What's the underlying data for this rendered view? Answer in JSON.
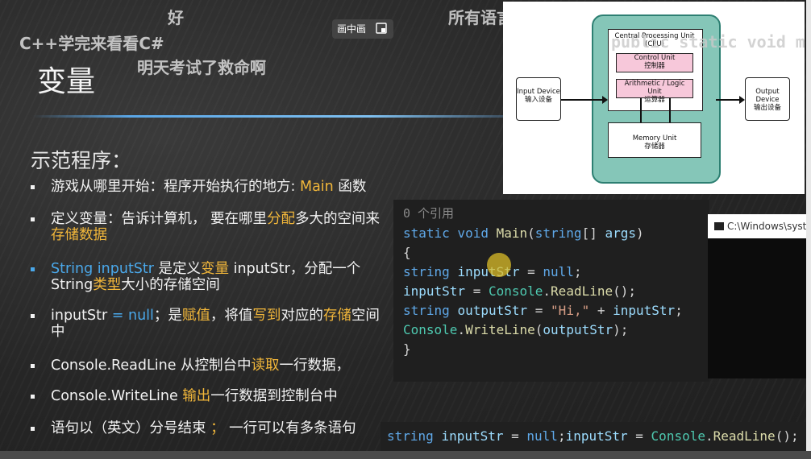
{
  "danmaku": {
    "line1": "好",
    "line2": "C++学完来看看C#",
    "line3": "明天考试了救命啊",
    "line4": "所有语言这个都差不多",
    "line5": "public static void m"
  },
  "pip_button": {
    "label": "画中画"
  },
  "slide": {
    "title": "变量",
    "section": "示范程序：",
    "bullets": [
      {
        "parts": [
          {
            "t": "游戏从哪里开始：程序开始执行的地方: "
          },
          {
            "t": "Main",
            "c": "hl"
          },
          {
            "t": " 函数"
          }
        ]
      },
      {
        "parts": [
          {
            "t": "定义变量：告诉计算机， 要在哪里"
          },
          {
            "t": "分配",
            "c": "hl"
          },
          {
            "t": "多大的空间来"
          },
          {
            "t": "存储数据",
            "c": "hl"
          }
        ]
      },
      {
        "parts": [
          {
            "t": "String inputStr ",
            "c": "kw"
          },
          {
            "t": "是定义"
          },
          {
            "t": "变量",
            "c": "hl"
          },
          {
            "t": " inputStr，分配一个String"
          },
          {
            "t": "类型",
            "c": "hl"
          },
          {
            "t": "大小的存储空间"
          }
        ]
      },
      {
        "parts": [
          {
            "t": "inputStr "
          },
          {
            "t": "= null",
            "c": "kw"
          },
          {
            "t": "；是"
          },
          {
            "t": "赋值",
            "c": "hl"
          },
          {
            "t": "，将值"
          },
          {
            "t": "写到",
            "c": "hl"
          },
          {
            "t": "对应的"
          },
          {
            "t": "存储",
            "c": "hl"
          },
          {
            "t": "空间中"
          }
        ]
      },
      {
        "parts": [
          {
            "t": "Console.ReadLine 从控制台中"
          },
          {
            "t": "读取",
            "c": "hl"
          },
          {
            "t": "一行数据，"
          }
        ]
      },
      {
        "parts": [
          {
            "t": "Console.WriteLine "
          },
          {
            "t": "输出",
            "c": "hl"
          },
          {
            "t": "一行数据到控制台中"
          }
        ]
      },
      {
        "parts": [
          {
            "t": "语句以（英文）分号结束 "
          },
          {
            "t": "；",
            "c": "hl"
          },
          {
            "t": " 一行可以有多条语句"
          }
        ]
      }
    ]
  },
  "cpu_diagram": {
    "cpu_title": "Central Processing Unit",
    "cpu_abbr": "(CPU)",
    "control_unit": "Control Unit",
    "control_unit_cn": "控制器",
    "alu": "Arithmetic / Logic Unit",
    "alu_cn": "运算器",
    "memory": "Memory Unit",
    "memory_cn": "存储器",
    "input": "Input Device",
    "input_cn": "输入设备",
    "output": "Output Device",
    "output_cn": "输出设备"
  },
  "code": {
    "refs": "0 个引用",
    "lines": [
      [
        {
          "t": "static void ",
          "c": "c-blue"
        },
        {
          "t": "Main",
          "c": "c-yellow"
        },
        {
          "t": "("
        },
        {
          "t": "string",
          "c": "c-blue"
        },
        {
          "t": "[] "
        },
        {
          "t": "args",
          "c": "c-ident"
        },
        {
          "t": ")"
        }
      ],
      [
        {
          "t": "{"
        }
      ],
      [
        {
          "t": "  "
        },
        {
          "t": "string ",
          "c": "c-blue"
        },
        {
          "t": "inputStr",
          "c": "c-ident"
        },
        {
          "t": " = "
        },
        {
          "t": "null",
          "c": "c-blue"
        },
        {
          "t": ";"
        }
      ],
      [
        {
          "t": "  "
        },
        {
          "t": "inputStr",
          "c": "c-ident"
        },
        {
          "t": " = "
        },
        {
          "t": "Console",
          "c": "c-teal"
        },
        {
          "t": "."
        },
        {
          "t": "ReadLine",
          "c": "c-yellow"
        },
        {
          "t": "();"
        }
      ],
      [
        {
          "t": "  "
        },
        {
          "t": "string ",
          "c": "c-blue"
        },
        {
          "t": "outputStr",
          "c": "c-ident"
        },
        {
          "t": " = "
        },
        {
          "t": "\"Hi,\"",
          "c": "c-str"
        },
        {
          "t": " + "
        },
        {
          "t": "inputStr",
          "c": "c-ident"
        },
        {
          "t": ";"
        }
      ],
      [
        {
          "t": "  "
        },
        {
          "t": "Console",
          "c": "c-teal"
        },
        {
          "t": "."
        },
        {
          "t": "WriteLine",
          "c": "c-yellow"
        },
        {
          "t": "("
        },
        {
          "t": "outputStr",
          "c": "c-ident"
        },
        {
          "t": ");"
        }
      ],
      [
        {
          "t": "}"
        }
      ]
    ],
    "bottom_line": [
      {
        "t": "string ",
        "c": "c-blue"
      },
      {
        "t": "inputStr",
        "c": "c-ident"
      },
      {
        "t": " = "
      },
      {
        "t": "null",
        "c": "c-blue"
      },
      {
        "t": ";"
      },
      {
        "t": "inputStr",
        "c": "c-ident"
      },
      {
        "t": " = "
      },
      {
        "t": "Console",
        "c": "c-teal"
      },
      {
        "t": "."
      },
      {
        "t": "ReadLine",
        "c": "c-yellow"
      },
      {
        "t": "();"
      }
    ]
  },
  "console_window": {
    "title": "C:\\Windows\\system"
  },
  "colors": {
    "highlight": "#f2b73a",
    "keyword": "#4aa8ea",
    "cpu_fill": "#85c6b8",
    "unit_fill": "#f7c8da"
  }
}
